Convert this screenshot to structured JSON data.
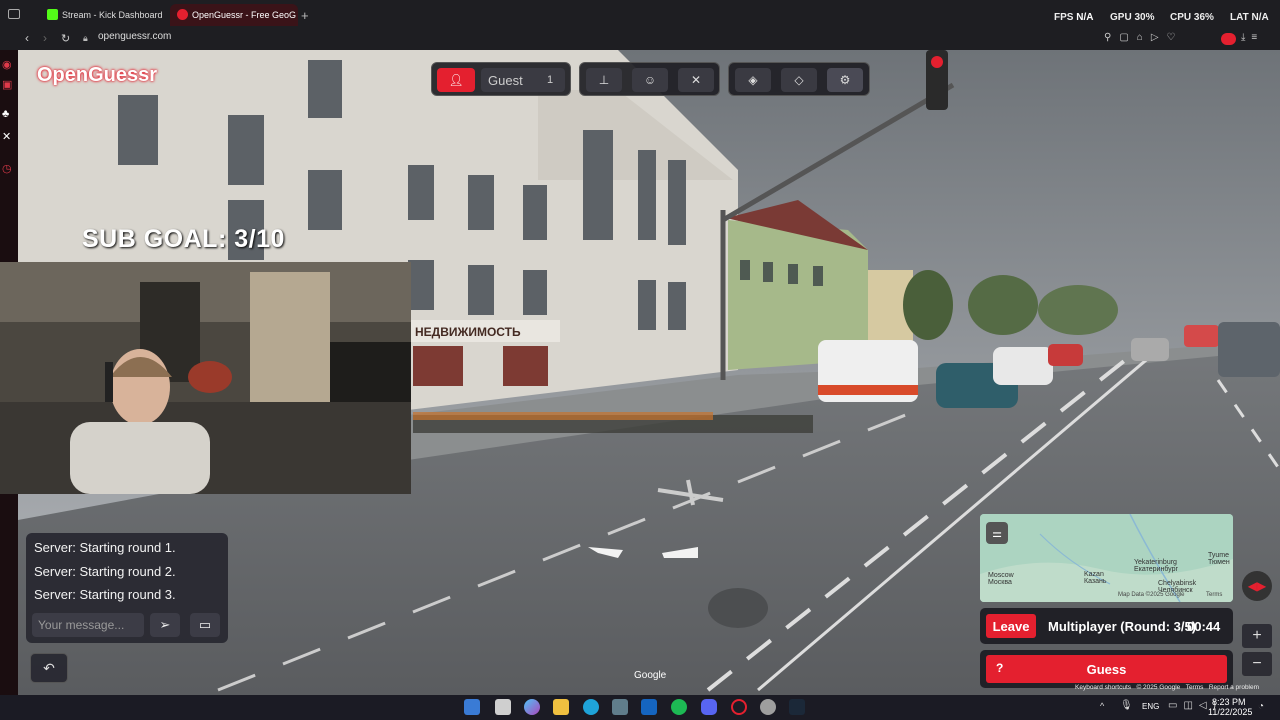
{
  "browser": {
    "tabs": [
      {
        "label": "Stream - Kick Dashboard"
      },
      {
        "label": "OpenGuessr - Free GeoG"
      }
    ],
    "new_tab": "+",
    "url": "openguessr.com"
  },
  "overlay_stats": {
    "fps_label": "FPS",
    "fps_value": "N/A",
    "gpu_label": "GPU",
    "gpu_value": "30%",
    "cpu_label": "CPU",
    "cpu_value": "36%",
    "lat_label": "LAT",
    "lat_value": "N/A"
  },
  "game": {
    "brand": "OpenGuessr",
    "player_label": "Guest",
    "player_count": "1",
    "sub_goal": "SUB GOAL: 3/10",
    "street_sign": "НЕДВИЖИМОСТЬ",
    "google_watermark": "Google"
  },
  "chat": {
    "messages": [
      "Server: Starting round 1.",
      "Server: Starting round 2.",
      "Server: Starting round 3."
    ],
    "input_placeholder": "Your message..."
  },
  "map": {
    "labels": {
      "yekaterinburg": "Yekaterinburg\nЕкатеринбург",
      "tyumen": "Tyume\nТюмен",
      "moscow": "Moscow\nМосква",
      "kazan": "Kazan\nКазань",
      "chelyabinsk": "Chelyabinsk\nЧелябинск"
    },
    "attribution": "Map Data ©2025 Google",
    "terms": "Terms"
  },
  "status_bar": {
    "leave_label": "Leave",
    "round_text": "Multiplayer (Round: 3/5)",
    "timer": "00:44"
  },
  "guess": {
    "help_icon": "?",
    "label": "Guess"
  },
  "footer": {
    "shortcuts": "Keyboard shortcuts",
    "copyright": "© 2025 Google",
    "terms": "Terms",
    "report": "Report a problem"
  },
  "taskbar": {
    "lang": "ENG",
    "time": "8:23 PM",
    "date": "11/22/2025"
  },
  "colors": {
    "accent": "#e4202f",
    "panel": "#1e1e24"
  }
}
